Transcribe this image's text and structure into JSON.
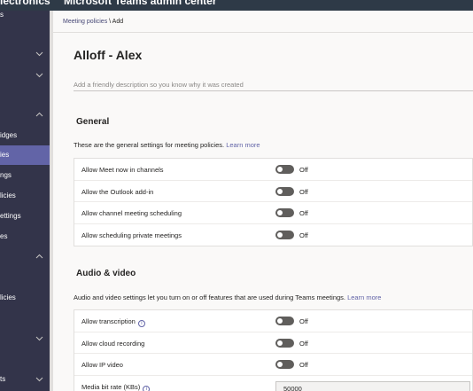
{
  "topbar": {
    "org": "Electronics",
    "app": "Microsoft Teams admin center"
  },
  "sidebar": {
    "items": [
      {
        "label": "s",
        "active": false
      },
      {
        "label": "idges",
        "active": false
      },
      {
        "label": "ies",
        "active": true
      },
      {
        "label": "ngs",
        "active": false
      },
      {
        "label": "licies",
        "active": false
      },
      {
        "label": "ettings",
        "active": false
      },
      {
        "label": "es",
        "active": false
      },
      {
        "label": "licies",
        "active": false
      },
      {
        "label": "ts",
        "active": false
      }
    ]
  },
  "breadcrumb": {
    "parent": "Meeting policies",
    "separator": "\\",
    "current": "Add"
  },
  "policy": {
    "name": "Alloff - Alex",
    "description_placeholder": "Add a friendly description so you know why it was created"
  },
  "general": {
    "title": "General",
    "description": "These are the general settings for meeting policies.",
    "link": "Learn more",
    "settings": [
      {
        "label": "Allow Meet now in channels",
        "state": "Off",
        "info": false
      },
      {
        "label": "Allow the Outlook add-in",
        "state": "Off",
        "info": false
      },
      {
        "label": "Allow channel meeting scheduling",
        "state": "Off",
        "info": false
      },
      {
        "label": "Allow scheduling private meetings",
        "state": "Off",
        "info": false
      }
    ]
  },
  "audio_video": {
    "title": "Audio & video",
    "description": "Audio and video settings let you turn on or off features that are used during Teams meetings.",
    "link": "Learn more",
    "settings": [
      {
        "label": "Allow transcription",
        "state": "Off",
        "info": true
      },
      {
        "label": "Allow cloud recording",
        "state": "Off",
        "info": false
      },
      {
        "label": "Allow IP video",
        "state": "Off",
        "info": false
      }
    ],
    "bitrate": {
      "label": "Media bit rate (KBs)",
      "value": "50000",
      "info": true
    }
  },
  "colors": {
    "accent": "#6264a7",
    "sidebar": "#33344a",
    "topbar": "#2e3a47",
    "toggle_off": "#605e5c"
  },
  "icons": {
    "chevron_down": "chevron-down-icon",
    "chevron_up": "chevron-up-icon",
    "info": "info-icon"
  }
}
